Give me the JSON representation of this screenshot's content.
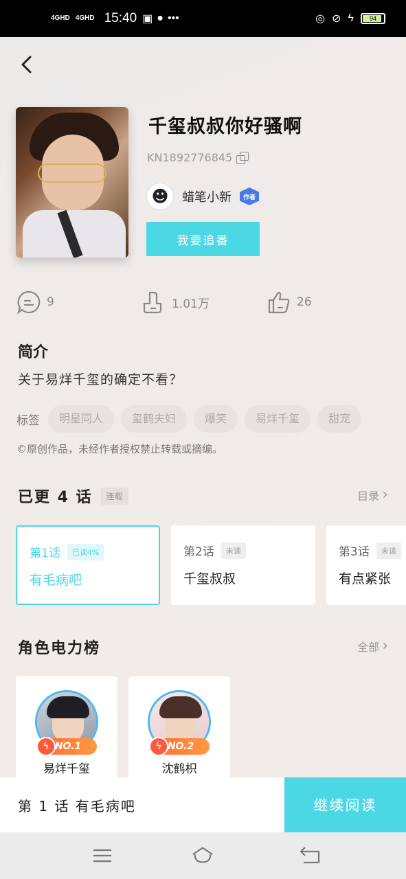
{
  "status_bar": {
    "signal_1": "4GHD",
    "signal_2": "4GHD",
    "time": "15:40",
    "battery": "94"
  },
  "book": {
    "title": "千玺叔叔你好骚啊",
    "id": "KN1892776845",
    "author_name": "蜡笔小新",
    "author_badge": "作者",
    "follow_label": "我要追番"
  },
  "stats": {
    "comments": "9",
    "dislikes": "1.01万",
    "likes": "26"
  },
  "intro": {
    "heading": "简介",
    "text": "关于易烊千玺的确定不看？"
  },
  "tags": {
    "label": "标签",
    "items": [
      "明星同人",
      "玺鹤夫妇",
      "爆笑",
      "易烊千玺",
      "甜宠"
    ]
  },
  "copyright": "©原创作品，未经作者授权禁止转载或摘编。",
  "episodes": {
    "title": "已更 4 话",
    "status": "连载",
    "link": "目录",
    "items": [
      {
        "num": "第1话",
        "badge": "已读4%",
        "name": "有毛病吧"
      },
      {
        "num": "第2话",
        "badge": "未读",
        "name": "千玺叔叔"
      },
      {
        "num": "第3话",
        "badge": "未读",
        "name": "有点紧张"
      }
    ]
  },
  "characters": {
    "title": "角色电力榜",
    "link": "全部",
    "items": [
      {
        "rank": "NO.1",
        "name": "易烊千玺"
      },
      {
        "rank": "NO.2",
        "name": "沈鹤枳"
      }
    ]
  },
  "bottom": {
    "current_episode": "第 1 话 有毛病吧",
    "continue_label": "继续阅读"
  },
  "colors": {
    "accent": "#4cd7e4",
    "rank_orange": "#ff6a3d",
    "avatar_ring": "#4cb8f0"
  }
}
